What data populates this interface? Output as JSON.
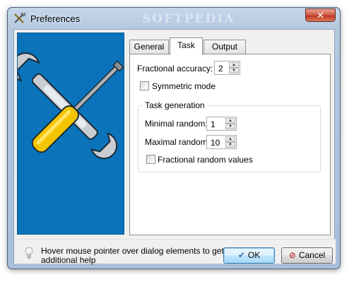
{
  "window": {
    "title": "Preferences",
    "watermark": "SOFTPEDIA",
    "close_glyph": "✕"
  },
  "tabs": [
    {
      "label": "General",
      "active": false
    },
    {
      "label": "Task",
      "active": true
    },
    {
      "label": "Output",
      "active": false
    }
  ],
  "task": {
    "fractional_accuracy_label": "Fractional accuracy:",
    "fractional_accuracy_value": "2",
    "symmetric_mode_label": "Symmetric mode",
    "symmetric_mode_checked": false,
    "group_title": "Task generation",
    "minimal_random_label": "Minimal random:",
    "minimal_random_value": "1",
    "maximal_random_label": "Maximal random:",
    "maximal_random_value": "10",
    "fractional_random_label": "Fractional random values",
    "fractional_random_checked": false
  },
  "footer": {
    "help_text": "Hover mouse pointer over dialog elements to get additional help",
    "ok_label": "OK",
    "cancel_label": "Cancel"
  },
  "colors": {
    "banner": "#0b73b9",
    "wrench": "#d0d4d8",
    "screwdriver_handle": "#f5c400"
  },
  "icons": {
    "title": "tools-icon",
    "banner": "wrench-screwdriver-icon",
    "help": "lightbulb-icon",
    "ok": "checkmark-icon",
    "cancel": "no-entry-icon"
  }
}
